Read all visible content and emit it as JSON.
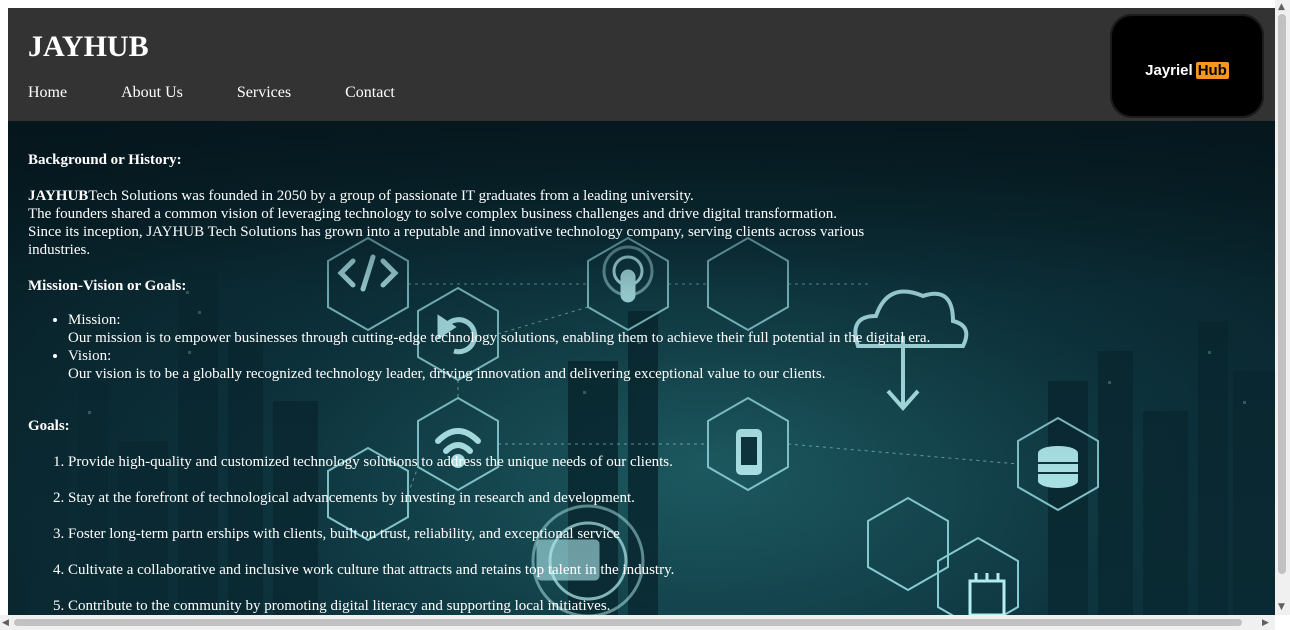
{
  "header": {
    "site_title": "JAYHUB",
    "nav": [
      "Home",
      "About Us",
      "Services",
      "Contact"
    ],
    "logo": {
      "word1": "Jayriel",
      "word2": "Hub",
      "accent": "#f7971e"
    }
  },
  "content": {
    "background_heading": "Background or History:",
    "history": {
      "bold_lead": "JAYHUB",
      "line1": "Tech Solutions was founded in 2050 by a group of passionate IT graduates from a leading university.",
      "line2": "The founders shared a common vision of leveraging technology to solve complex business challenges and drive digital transformation.",
      "line3": "Since its inception, JAYHUB Tech Solutions has grown into a reputable and innovative technology company, serving clients across various industries."
    },
    "mission_heading": "Mission-Vision or Goals:",
    "mission": {
      "label": "Mission:",
      "text": "Our mission is to empower businesses through cutting-edge technology solutions, enabling them to achieve their full potential in the digital era."
    },
    "vision": {
      "label": "Vision:",
      "text": "Our vision is to be a globally recognized technology leader, driving innovation and delivering exceptional value to our clients."
    },
    "goals_heading": "Goals:",
    "goals": [
      "Provide high-quality and customized technology solutions to address the unique needs of our clients.",
      "Stay at the forefront of technological advancements by investing in research and development.",
      "Foster long-term partn erships with clients, built on trust, reliability, and exceptional service",
      "Cultivate a collaborative and inclusive work culture that attracts and retains top talent in the industry.",
      "Contribute to the community by promoting digital literacy and supporting local initiatives."
    ]
  },
  "icons": [
    "code-icon",
    "touch-icon",
    "refresh-icon",
    "cloud-download-icon",
    "wifi-icon",
    "mobile-icon",
    "database-icon",
    "chip-icon",
    "laptop-icon"
  ],
  "colors": {
    "header_bg": "#333333",
    "text": "#ffffff",
    "hero_line": "#9fe8ee"
  }
}
